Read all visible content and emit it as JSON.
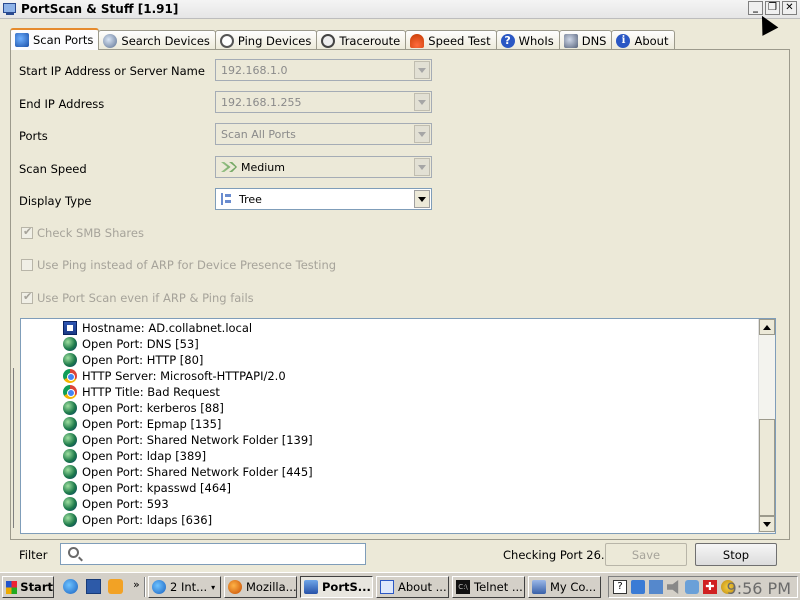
{
  "window": {
    "title": "PortScan & Stuff [1.91]"
  },
  "tabs": [
    {
      "label": "Scan Ports",
      "icon": "scan-ports-icon",
      "active": true
    },
    {
      "label": "Search Devices",
      "icon": "search-devices-icon"
    },
    {
      "label": "Ping Devices",
      "icon": "ping-icon"
    },
    {
      "label": "Traceroute",
      "icon": "traceroute-icon"
    },
    {
      "label": "Speed Test",
      "icon": "speedometer-icon"
    },
    {
      "label": "WhoIs",
      "icon": "question-icon"
    },
    {
      "label": "DNS",
      "icon": "dns-icon"
    },
    {
      "label": "About",
      "icon": "info-icon"
    }
  ],
  "form": {
    "start_ip_label": "Start IP Address or Server Name",
    "start_ip_value": "192.168.1.0",
    "end_ip_label": "End IP Address",
    "end_ip_value": "192.168.1.255",
    "ports_label": "Ports",
    "ports_value": "Scan All Ports",
    "speed_label": "Scan Speed",
    "speed_value": "Medium",
    "display_label": "Display Type",
    "display_value": "Tree",
    "check_smb": "Check SMB Shares",
    "use_ping": "Use Ping instead of ARP for Device Presence Testing",
    "use_portscan": "Use Port Scan even if ARP & Ping fails"
  },
  "results": [
    {
      "icon": "host",
      "text": "Hostname: AD.collabnet.local"
    },
    {
      "icon": "globe",
      "text": "Open Port: DNS [53]"
    },
    {
      "icon": "globe",
      "text": "Open Port: HTTP [80]"
    },
    {
      "icon": "chrome",
      "text": "HTTP Server: Microsoft-HTTPAPI/2.0"
    },
    {
      "icon": "chrome",
      "text": "HTTP Title: Bad Request"
    },
    {
      "icon": "globe",
      "text": "Open Port: kerberos [88]"
    },
    {
      "icon": "globe",
      "text": "Open Port: Epmap [135]"
    },
    {
      "icon": "globe",
      "text": "Open Port: Shared Network Folder [139]"
    },
    {
      "icon": "globe",
      "text": "Open Port: ldap [389]"
    },
    {
      "icon": "globe",
      "text": "Open Port: Shared Network Folder [445]"
    },
    {
      "icon": "globe",
      "text": "Open Port: kpasswd [464]"
    },
    {
      "icon": "globe",
      "text": "Open Port: 593"
    },
    {
      "icon": "globe",
      "text": "Open Port: ldaps [636]"
    }
  ],
  "bottom": {
    "filter_label": "Filter",
    "filter_value": "",
    "status": "Checking Port 26...",
    "save_label": "Save",
    "stop_label": "Stop"
  },
  "taskbar": {
    "start_label": "Start",
    "quicklaunch_more": "»",
    "tasks": [
      {
        "label": "2 Int...",
        "icon": "ie-icon",
        "active": false
      },
      {
        "label": "Mozilla...",
        "icon": "firefox-icon",
        "active": false
      },
      {
        "label": "PortS...",
        "icon": "portscan-icon",
        "active": true
      },
      {
        "label": "About ...",
        "icon": "about-window-icon",
        "active": false
      },
      {
        "label": "Telnet ...",
        "icon": "cmd-icon",
        "active": false
      },
      {
        "label": "My Co...",
        "icon": "computer-icon",
        "active": false
      }
    ],
    "clock": "9:56 PM"
  }
}
